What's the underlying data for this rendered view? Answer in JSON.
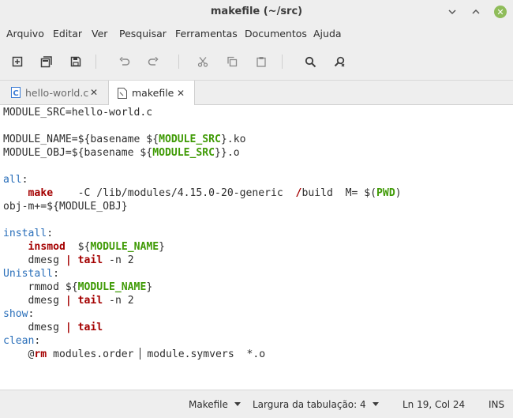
{
  "window": {
    "title": "makefile (~/src)",
    "controls": [
      {
        "name": "minimize-icon",
        "glyph": "⌄"
      },
      {
        "name": "maximize-icon",
        "glyph": "⌃"
      },
      {
        "name": "close-icon",
        "glyph": "✕"
      }
    ]
  },
  "menu": [
    {
      "label": "Arquivo"
    },
    {
      "label": "Editar"
    },
    {
      "label": "Ver"
    },
    {
      "label": "Pesquisar"
    },
    {
      "label": "Ferramentas"
    },
    {
      "label": "Documentos"
    },
    {
      "label": "Ajuda"
    }
  ],
  "toolbar_icons": [
    "new-document-icon",
    "new-window-icon",
    "save-icon",
    "undo-icon",
    "redo-icon",
    "cut-icon",
    "copy-icon",
    "paste-icon",
    "search-icon",
    "find-replace-icon"
  ],
  "tabs": [
    {
      "label": "hello-world.c",
      "icon": "c-file-icon",
      "active": false
    },
    {
      "label": "makefile",
      "icon": "text-file-icon",
      "active": true
    }
  ],
  "tab_close_glyph": "✕",
  "code_lines": [
    [
      {
        "t": "MODULE_SRC=hello-world.c",
        "c": "n"
      }
    ],
    [],
    [
      {
        "t": "MODULE_NAME=${basename ${",
        "c": "n"
      },
      {
        "t": "MODULE_SRC",
        "c": "var"
      },
      {
        "t": "}.ko",
        "c": "n"
      }
    ],
    [
      {
        "t": "MODULE_OBJ=${basename ${",
        "c": "n"
      },
      {
        "t": "MODULE_SRC",
        "c": "var"
      },
      {
        "t": "}}.o",
        "c": "n"
      }
    ],
    [],
    [
      {
        "t": "all",
        "c": "tgt"
      },
      {
        "t": ":",
        "c": "n"
      }
    ],
    [
      {
        "t": "    ",
        "c": "n"
      },
      {
        "t": "make",
        "c": "kw"
      },
      {
        "t": "    -C /lib/modules/4.15.0-20-generic  ",
        "c": "n"
      },
      {
        "t": "/",
        "c": "kw"
      },
      {
        "t": "build  M= $(",
        "c": "n"
      },
      {
        "t": "PWD",
        "c": "var"
      },
      {
        "t": ")",
        "c": "n"
      }
    ],
    [
      {
        "t": "obj-m+=${MODULE_OBJ}",
        "c": "n"
      }
    ],
    [],
    [
      {
        "t": "install",
        "c": "tgt"
      },
      {
        "t": ":",
        "c": "n"
      }
    ],
    [
      {
        "t": "    ",
        "c": "n"
      },
      {
        "t": "insmod",
        "c": "kw"
      },
      {
        "t": "  ${",
        "c": "n"
      },
      {
        "t": "MODULE_NAME",
        "c": "var"
      },
      {
        "t": "}",
        "c": "n"
      }
    ],
    [
      {
        "t": "    dmesg ",
        "c": "n"
      },
      {
        "t": "|",
        "c": "kw"
      },
      {
        "t": " ",
        "c": "n"
      },
      {
        "t": "tail",
        "c": "kw"
      },
      {
        "t": " -n 2",
        "c": "n"
      }
    ],
    [
      {
        "t": "Unistall",
        "c": "tgt"
      },
      {
        "t": ":",
        "c": "n"
      }
    ],
    [
      {
        "t": "    rmmod ${",
        "c": "n"
      },
      {
        "t": "MODULE_NAME",
        "c": "var"
      },
      {
        "t": "}",
        "c": "n"
      }
    ],
    [
      {
        "t": "    dmesg ",
        "c": "n"
      },
      {
        "t": "|",
        "c": "kw"
      },
      {
        "t": " ",
        "c": "n"
      },
      {
        "t": "tail",
        "c": "kw"
      },
      {
        "t": " -n 2",
        "c": "n"
      }
    ],
    [
      {
        "t": "show",
        "c": "tgt"
      },
      {
        "t": ":",
        "c": "n"
      }
    ],
    [
      {
        "t": "    dmesg ",
        "c": "n"
      },
      {
        "t": "|",
        "c": "kw"
      },
      {
        "t": " ",
        "c": "n"
      },
      {
        "t": "tail",
        "c": "kw"
      }
    ],
    [
      {
        "t": "clean",
        "c": "tgt"
      },
      {
        "t": ":",
        "c": "n"
      }
    ],
    [
      {
        "t": "    @",
        "c": "n"
      },
      {
        "t": "rm",
        "c": "kw"
      },
      {
        "t": " modules.order ",
        "c": "n"
      },
      {
        "t": "|CURSOR|",
        "c": "cursor"
      },
      {
        "t": " module.symvers  *.o",
        "c": "n"
      }
    ]
  ],
  "status": {
    "language": "Makefile",
    "tab_width": "Largura da tabulação: 4",
    "position": "Ln 19, Col 24",
    "mode": "INS"
  },
  "colors": {
    "target": "#2a6fba",
    "keyword": "#a40000",
    "variable": "#3f9a05",
    "close_button": "#8fbc5a"
  }
}
